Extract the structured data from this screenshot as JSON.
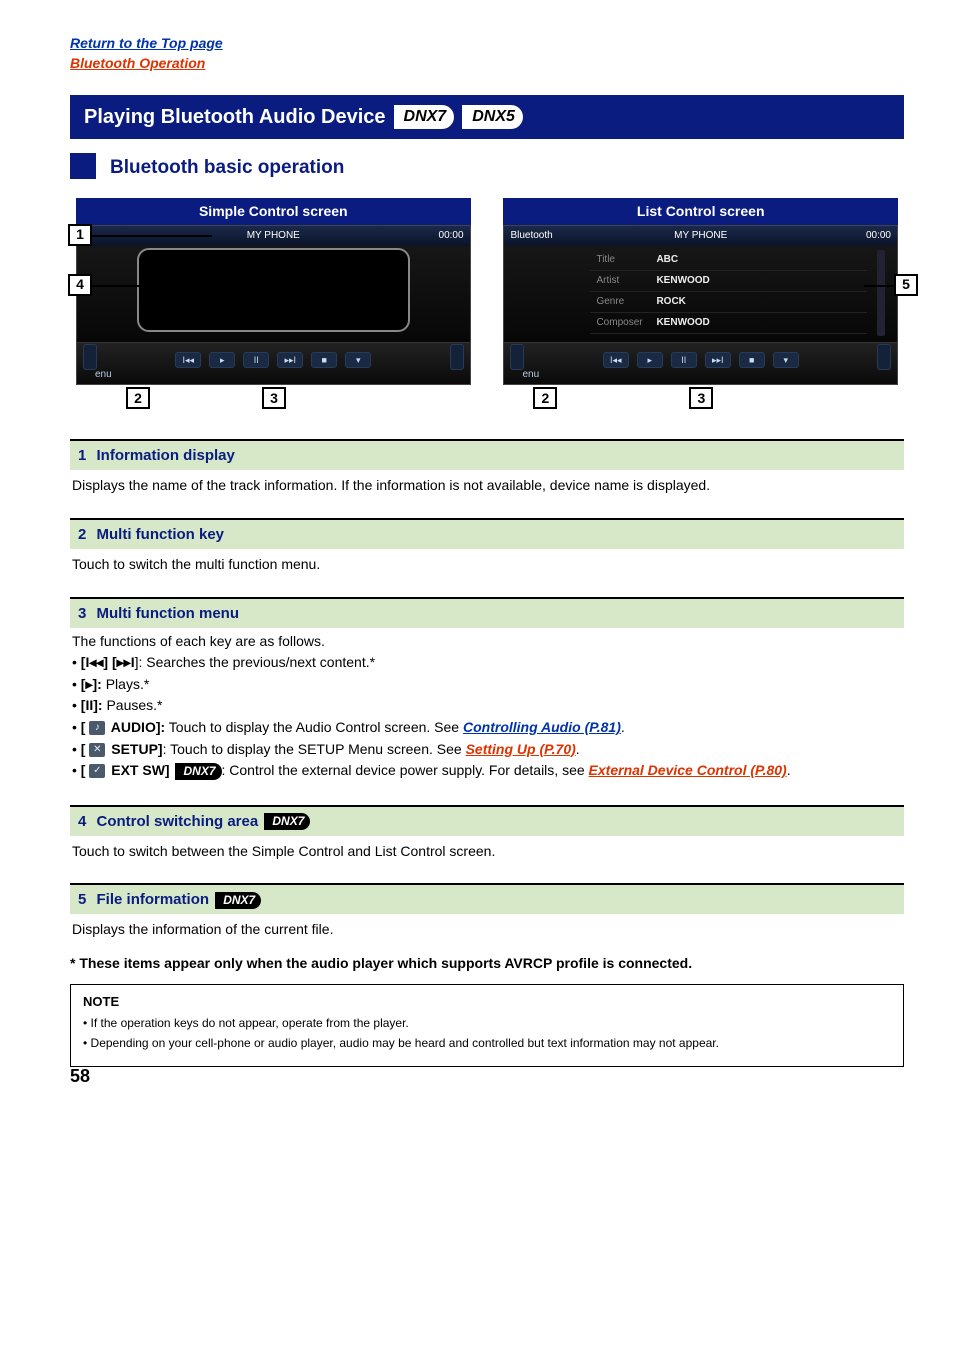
{
  "header": {
    "return_link": "Return to the Top page",
    "section_link": "Bluetooth Operation"
  },
  "title": {
    "text": "Playing Bluetooth Audio Device",
    "badges": [
      "DNX7",
      "DNX5"
    ]
  },
  "subsection": {
    "title": "Bluetooth basic operation"
  },
  "screens": {
    "simple_caption": "Simple Control screen",
    "list_caption": "List Control screen",
    "mock": {
      "device_name": "MY PHONE",
      "time": "00:00",
      "bt_label": "Bluetooth",
      "menu_label": "enu",
      "info": {
        "title_k": "Title",
        "title_v": "ABC",
        "artist_k": "Artist",
        "artist_v": "KENWOOD",
        "genre_k": "Genre",
        "genre_v": "ROCK",
        "composer_k": "Composer",
        "composer_v": "KENWOOD"
      },
      "controls": [
        "I◂◂",
        "▸",
        "II",
        "▸▸I",
        "■",
        "▾"
      ]
    }
  },
  "callouts": {
    "c1": "1",
    "c2": "2",
    "c3": "3",
    "c4": "4",
    "c5": "5"
  },
  "desc": {
    "d1": {
      "num": "1",
      "title": "Information display",
      "body": "Displays the name of the track information. If the information is not available, device name is displayed."
    },
    "d2": {
      "num": "2",
      "title": "Multi function key",
      "body": "Touch to switch the multi function menu."
    },
    "d3": {
      "num": "3",
      "title": "Multi function menu",
      "intro": "The functions of each key are as follows.",
      "b1_a": "[",
      "b1_b": "] [",
      "b1_c": "]: Searches the previous/next content.*",
      "b1_sym_prev": "I◂◂",
      "b1_sym_next": "▸▸I",
      "b2_a": "[",
      "b2_symbol": "▸",
      "b2_b": "]:",
      "b2_c": " Plays.*",
      "b3_a": "[",
      "b3_symbol": "II",
      "b3_b": "]:",
      "b3_c": " Pauses.*",
      "b4_pre": "[ ",
      "b4_label": " AUDIO]:",
      "b4_body": " Touch to display the Audio Control screen. See ",
      "b4_link": "Controlling Audio (P.81)",
      "b4_tail": ".",
      "b5_pre": "[ ",
      "b5_label": " SETUP]",
      "b5_body": ": Touch to display the SETUP Menu screen. See ",
      "b5_link": "Setting Up (P.70)",
      "b5_tail": ".",
      "b6_pre": "[ ",
      "b6_label": " EXT SW] ",
      "b6_badge": "DNX7",
      "b6_body": ": Control the external device power supply. For details, see ",
      "b6_link": "External Device Control (P.80)",
      "b6_tail": "."
    },
    "d4": {
      "num": "4",
      "title": "Control switching area",
      "badge": "DNX7",
      "body": "Touch to switch between the Simple Control and List Control screen."
    },
    "d5": {
      "num": "5",
      "title": "File information",
      "badge": "DNX7",
      "body": "Displays the information of the current file."
    }
  },
  "asterisk": "* These items appear only when the audio player which supports AVRCP profile is connected.",
  "note": {
    "title": "NOTE",
    "n1": "If the operation keys do not appear, operate from the player.",
    "n2": "Depending on your cell-phone or audio player, audio may be heard and controlled but text information may not appear."
  },
  "icons": {
    "audio": "♪",
    "setup": "✕",
    "ext": "✓"
  },
  "page_number": "58"
}
